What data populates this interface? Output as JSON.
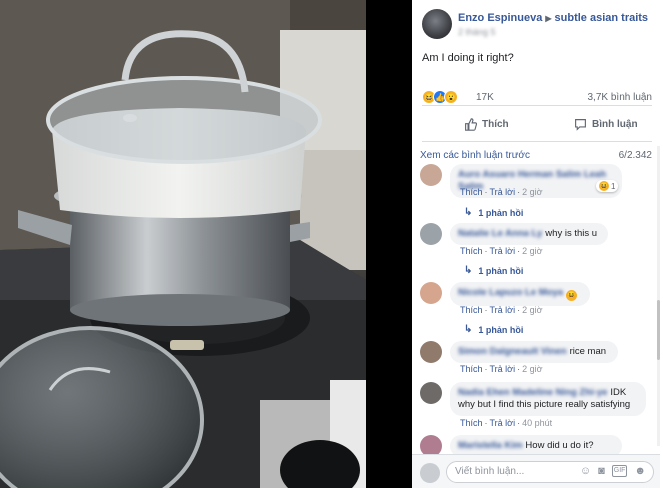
{
  "post": {
    "author": "Enzo Espinueva",
    "group": "subtle asian traits",
    "meta_date": "2 tháng 5",
    "text": "Am I doing it right?",
    "reaction_count": "17K",
    "comment_count": "3,7K bình luận",
    "like_label": "Thích",
    "comment_label": "Bình luận"
  },
  "comments_section": {
    "view_previous": "Xem các bình luận trước",
    "previous_count": "6/2.342",
    "comments": [
      {
        "name": "Auro Asuaro Herman Salim Leah Salim",
        "text": "",
        "like": "Thích",
        "reply": "Trả lời",
        "time": "2 giờ",
        "reaction_count": "1",
        "replies": "1 phản hồi"
      },
      {
        "name": "Natalie Le Anna Ly",
        "text": "why is this u",
        "like": "Thích",
        "reply": "Trả lời",
        "time": "2 giờ",
        "replies": "1 phản hồi"
      },
      {
        "name": "Nicole Lapuzo Le Moya",
        "text": "",
        "like": "Thích",
        "reply": "Trả lời",
        "time": "2 giờ",
        "replies": "1 phản hồi"
      },
      {
        "name": "Simon Dalgneault Vinen",
        "text": "rice man",
        "like": "Thích",
        "reply": "Trả lời",
        "time": "2 giờ"
      },
      {
        "name": "Nadia Ehen Madeline Ning Zhi-ye",
        "text": "IDK",
        "text2": "why but I find this picture really satisfying",
        "like": "Thích",
        "reply": "Trả lời",
        "time": "40 phút"
      },
      {
        "name": "Maristella Kim",
        "text": "How did u do it?"
      }
    ]
  },
  "composer": {
    "placeholder": "Viết bình luận..."
  },
  "icons": {
    "like": "thumbs-up-icon",
    "comment": "speech-bubble-icon",
    "emoji": "smiley-icon",
    "camera": "camera-icon",
    "gif": "gif-icon",
    "sticker": "sticker-icon"
  },
  "colors": {
    "link": "#385898",
    "haha": "#f7b125",
    "like": "#2078f4"
  }
}
